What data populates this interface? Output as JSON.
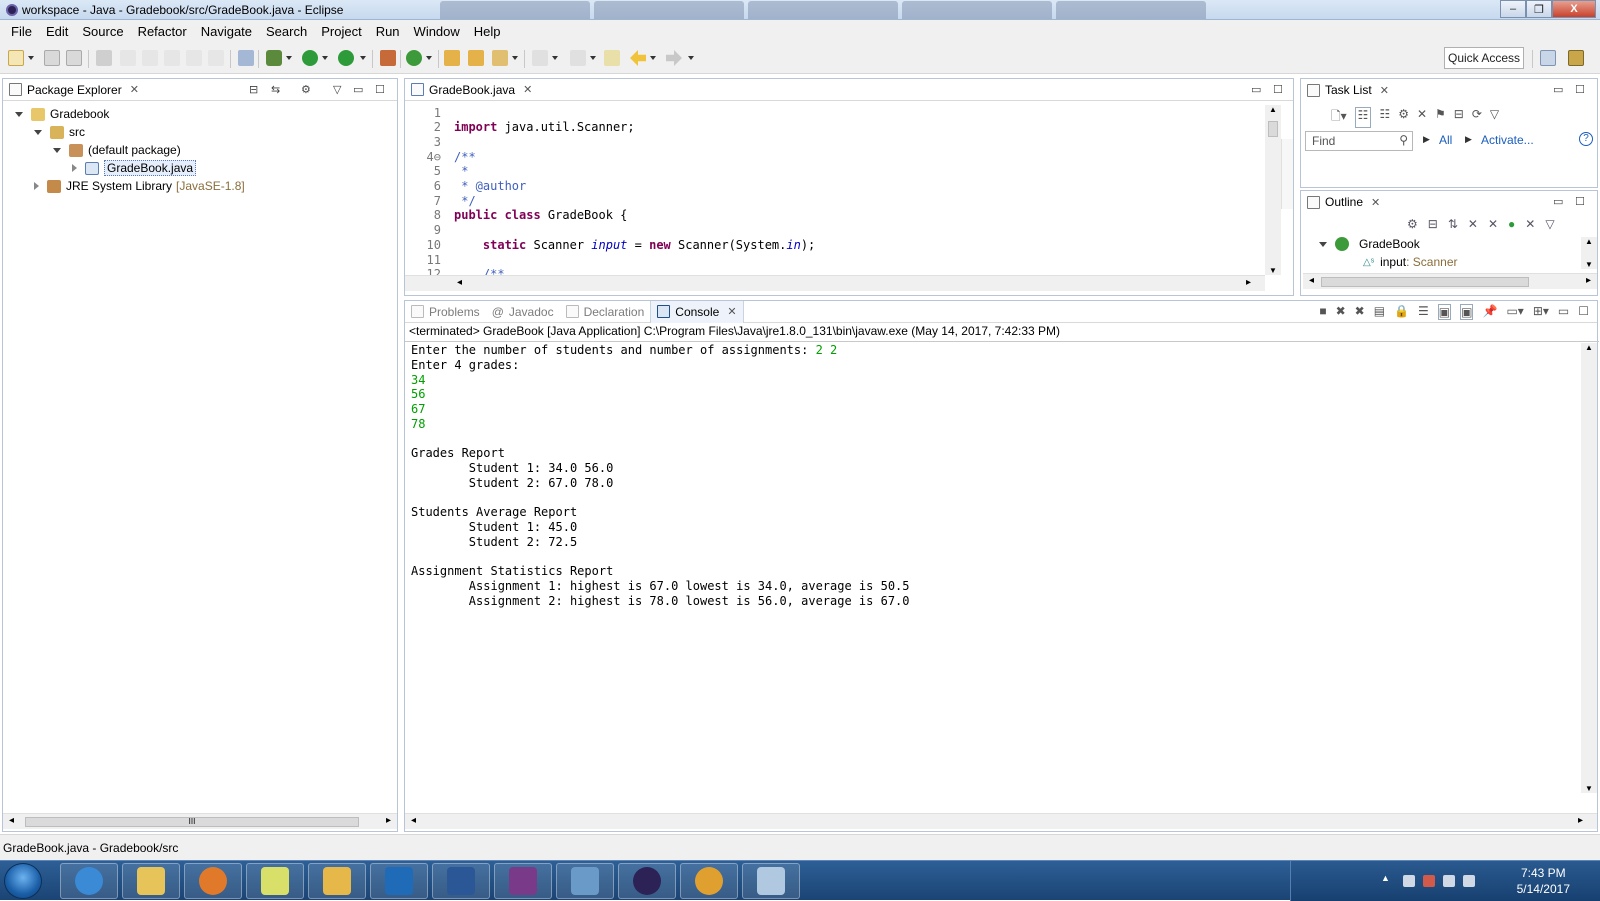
{
  "window": {
    "title": "workspace - Java - Gradebook/src/GradeBook.java - Eclipse",
    "minimize": "–",
    "maximize": "❐",
    "close": "X"
  },
  "menu": [
    "File",
    "Edit",
    "Source",
    "Refactor",
    "Navigate",
    "Search",
    "Project",
    "Run",
    "Window",
    "Help"
  ],
  "toolbar": {
    "quick_access": "Quick Access"
  },
  "package_explorer": {
    "tab_label": "Package Explorer",
    "tree": [
      {
        "label": "Gradebook",
        "depth": 0,
        "expanded": true,
        "icon": "project-icon"
      },
      {
        "label": "src",
        "depth": 1,
        "expanded": true,
        "icon": "source-folder-icon"
      },
      {
        "label": "(default package)",
        "depth": 2,
        "expanded": true,
        "icon": "package-icon"
      },
      {
        "label": "GradeBook.java",
        "depth": 3,
        "expanded": false,
        "icon": "java-file-icon",
        "selected": true
      },
      {
        "label": "JRE System Library",
        "suffix": "[JavaSE-1.8]",
        "depth": 1,
        "expanded": false,
        "icon": "library-icon"
      }
    ],
    "scroll_thumb_label": "III"
  },
  "editor": {
    "tab_label": "GradeBook.java",
    "lines": [
      {
        "n": "1",
        "parts": []
      },
      {
        "n": "2",
        "parts": [
          {
            "t": "import",
            "c": "kw"
          },
          {
            "t": " java.util.Scanner;",
            "c": ""
          }
        ]
      },
      {
        "n": "3",
        "parts": []
      },
      {
        "n": "4⊖",
        "parts": [
          {
            "t": "/**",
            "c": "cm"
          }
        ]
      },
      {
        "n": "5",
        "parts": [
          {
            "t": " *",
            "c": "cm"
          }
        ]
      },
      {
        "n": "6",
        "parts": [
          {
            "t": " * @author",
            "c": "cm"
          }
        ]
      },
      {
        "n": "7",
        "parts": [
          {
            "t": " */",
            "c": "cm"
          }
        ]
      },
      {
        "n": "8",
        "parts": [
          {
            "t": "public class",
            "c": "kw"
          },
          {
            "t": " GradeBook {",
            "c": ""
          }
        ]
      },
      {
        "n": "9",
        "parts": []
      },
      {
        "n": "10",
        "parts": [
          {
            "t": "    static",
            "c": "kw"
          },
          {
            "t": " Scanner ",
            "c": ""
          },
          {
            "t": "input",
            "c": "fld"
          },
          {
            "t": " = ",
            "c": ""
          },
          {
            "t": "new",
            "c": "kw"
          },
          {
            "t": " Scanner(System.",
            "c": ""
          },
          {
            "t": "in",
            "c": "fld"
          },
          {
            "t": ");",
            "c": ""
          }
        ]
      },
      {
        "n": "11",
        "parts": []
      },
      {
        "n": "12",
        "parts": [
          {
            "t": "    /**",
            "c": "cm"
          }
        ]
      }
    ]
  },
  "task_list": {
    "tab_label": "Task List",
    "find_placeholder": "Find",
    "all_link": "All",
    "activate_link": "Activate...",
    "help": "?"
  },
  "outline": {
    "tab_label": "Outline",
    "items": [
      {
        "label": "GradeBook",
        "type": ""
      },
      {
        "label": "input",
        "type": " : Scanner"
      }
    ]
  },
  "bottom_tabs": {
    "problems": "Problems",
    "javadoc": "Javadoc",
    "declaration": "Declaration",
    "console": "Console"
  },
  "console": {
    "header": "<terminated> GradeBook [Java Application] C:\\Program Files\\Java\\jre1.8.0_131\\bin\\javaw.exe (May 14, 2017, 7:42:33 PM)",
    "lines": [
      {
        "parts": [
          {
            "t": "Enter the number of students and number of assignments: ",
            "c": ""
          },
          {
            "t": "2 2",
            "c": "cin"
          }
        ]
      },
      {
        "parts": [
          {
            "t": "Enter 4 grades:",
            "c": ""
          }
        ]
      },
      {
        "parts": [
          {
            "t": "34",
            "c": "cin"
          }
        ]
      },
      {
        "parts": [
          {
            "t": "56",
            "c": "cin"
          }
        ]
      },
      {
        "parts": [
          {
            "t": "67",
            "c": "cin"
          }
        ]
      },
      {
        "parts": [
          {
            "t": "78",
            "c": "cin"
          }
        ]
      },
      {
        "parts": []
      },
      {
        "parts": [
          {
            "t": "Grades Report",
            "c": ""
          }
        ]
      },
      {
        "parts": [
          {
            "t": "        Student 1: 34.0 56.0",
            "c": ""
          }
        ]
      },
      {
        "parts": [
          {
            "t": "        Student 2: 67.0 78.0",
            "c": ""
          }
        ]
      },
      {
        "parts": []
      },
      {
        "parts": [
          {
            "t": "Students Average Report",
            "c": ""
          }
        ]
      },
      {
        "parts": [
          {
            "t": "        Student 1: 45.0",
            "c": ""
          }
        ]
      },
      {
        "parts": [
          {
            "t": "        Student 2: 72.5",
            "c": ""
          }
        ]
      },
      {
        "parts": []
      },
      {
        "parts": [
          {
            "t": "Assignment Statistics Report",
            "c": ""
          }
        ]
      },
      {
        "parts": [
          {
            "t": "        Assignment 1: highest is 67.0 lowest is 34.0, average is 50.5",
            "c": ""
          }
        ]
      },
      {
        "parts": [
          {
            "t": "        Assignment 2: highest is 78.0 lowest is 56.0, average is 67.0",
            "c": ""
          }
        ]
      }
    ]
  },
  "status_bar": {
    "text": "GradeBook.java - Gradebook/src"
  },
  "taskbar": {
    "apps": [
      "internet-explorer-icon",
      "file-explorer-icon",
      "media-player-icon",
      "sticky-notes-icon",
      "file-manager-icon",
      "outlook-icon",
      "word-icon",
      "winrar-icon",
      "photo-viewer-icon",
      "eclipse-icon",
      "chrome-icon",
      "paint-icon"
    ],
    "clock_time": "7:43 PM",
    "clock_date": "5/14/2017"
  },
  "colors": {
    "keyword": "#7f0055",
    "comment": "#3f5fbf",
    "field": "#0000c0",
    "console_input": "#00a000"
  }
}
